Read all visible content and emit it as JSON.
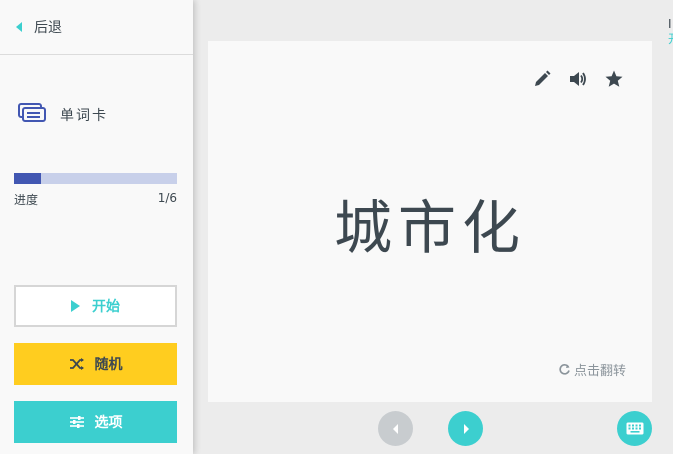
{
  "sidebar": {
    "back_label": "后退",
    "mode_label": "单词卡",
    "progress": {
      "label": "进度",
      "text": "1/6",
      "fraction": 0.1667
    },
    "buttons": {
      "start": "开始",
      "random": "随机",
      "options": "选项"
    }
  },
  "card": {
    "term": "城市化",
    "flip_hint": "点击翻转",
    "tools": [
      "edit-icon",
      "audio-icon",
      "star-icon"
    ]
  },
  "edge": {
    "line1": "I",
    "line2": "开"
  },
  "colors": {
    "teal": "#3ccfcf",
    "yellow": "#ffcd1f",
    "progress": "#4257b2",
    "progress_track": "#c8d0ea"
  }
}
